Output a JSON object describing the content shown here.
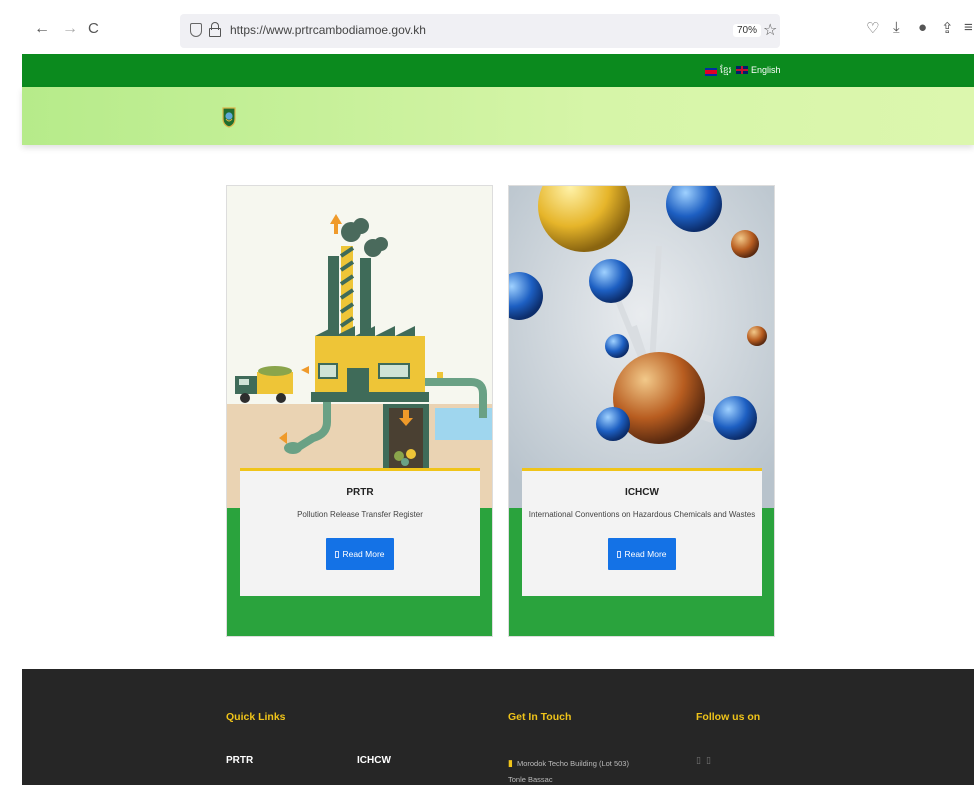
{
  "browser": {
    "url": "https://www.prtrcambodiamoe.gov.kh",
    "zoom": "70%",
    "back_glyph": "←",
    "forward_glyph": "→",
    "reload_glyph": "C",
    "star_glyph": "☆",
    "toolbar_glyphs": [
      "♡",
      "⤓",
      "●",
      "⇪",
      "≡"
    ],
    "icons": [
      "back-icon",
      "forward-icon",
      "reload-icon",
      "shield-icon",
      "lock-icon",
      "star-icon",
      "pocket-icon",
      "download-icon",
      "extension-icon",
      "share-icon",
      "menu-icon"
    ]
  },
  "topbar": {
    "lang_khmer": "ខ្មែរ",
    "lang_english": "English",
    "color": "#0b8a1e"
  },
  "cards": [
    {
      "title": "PRTR",
      "subtitle": "Pollution Release Transfer Register",
      "button": "Read More"
    },
    {
      "title": "ICHCW",
      "subtitle": "International Conventions on Hazardous Chemicals and Wastes",
      "button": "Read More"
    }
  ],
  "footer": {
    "quick_links_heading": "Quick Links",
    "links": [
      "PRTR",
      "ICHCW"
    ],
    "contact_heading": "Get In Touch",
    "address": "Morodok Techo Building (Lot 503) Tonle Bassac",
    "follow_heading": "Follow us on",
    "social_icons": [
      "facebook-icon",
      "youtube-icon"
    ],
    "heading_color": "#f0c419"
  }
}
